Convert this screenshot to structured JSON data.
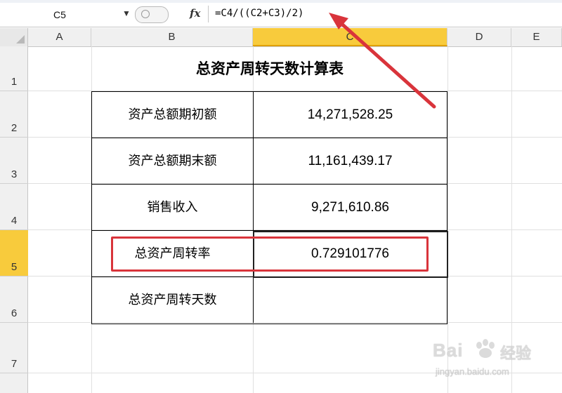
{
  "formula_bar": {
    "name_box": "C5",
    "fx_label": "fx",
    "formula": "=C4/((C2+C3)/2)"
  },
  "columns": [
    {
      "label": "A",
      "selected": false
    },
    {
      "label": "B",
      "selected": false
    },
    {
      "label": "C",
      "selected": true
    },
    {
      "label": "D",
      "selected": false
    },
    {
      "label": "E",
      "selected": false
    }
  ],
  "rows": [
    {
      "label": "1",
      "selected": false
    },
    {
      "label": "2",
      "selected": false
    },
    {
      "label": "3",
      "selected": false
    },
    {
      "label": "4",
      "selected": false
    },
    {
      "label": "5",
      "selected": true
    },
    {
      "label": "6",
      "selected": false
    },
    {
      "label": "7",
      "selected": false
    }
  ],
  "sheet": {
    "title": "总资产周转天数计算表",
    "table": [
      {
        "label": "资产总额期初额",
        "value": "14,271,528.25"
      },
      {
        "label": "资产总额期末额",
        "value": "11,161,439.17"
      },
      {
        "label": "销售收入",
        "value": "9,271,610.86"
      },
      {
        "label": "总资产周转率",
        "value": "0.729101776"
      },
      {
        "label": "总资产周转天数",
        "value": ""
      }
    ]
  },
  "annotation": {
    "color": "#d9343b",
    "highlight_row": "总资产周转率"
  },
  "watermark": {
    "brand_left": "Bai",
    "brand_right": "经验",
    "url": "jingyan.baidu.com"
  },
  "colors": {
    "header_bg": "#f0f0f0",
    "selected_header": "#f8cb3c",
    "annotation_red": "#d9343b"
  }
}
